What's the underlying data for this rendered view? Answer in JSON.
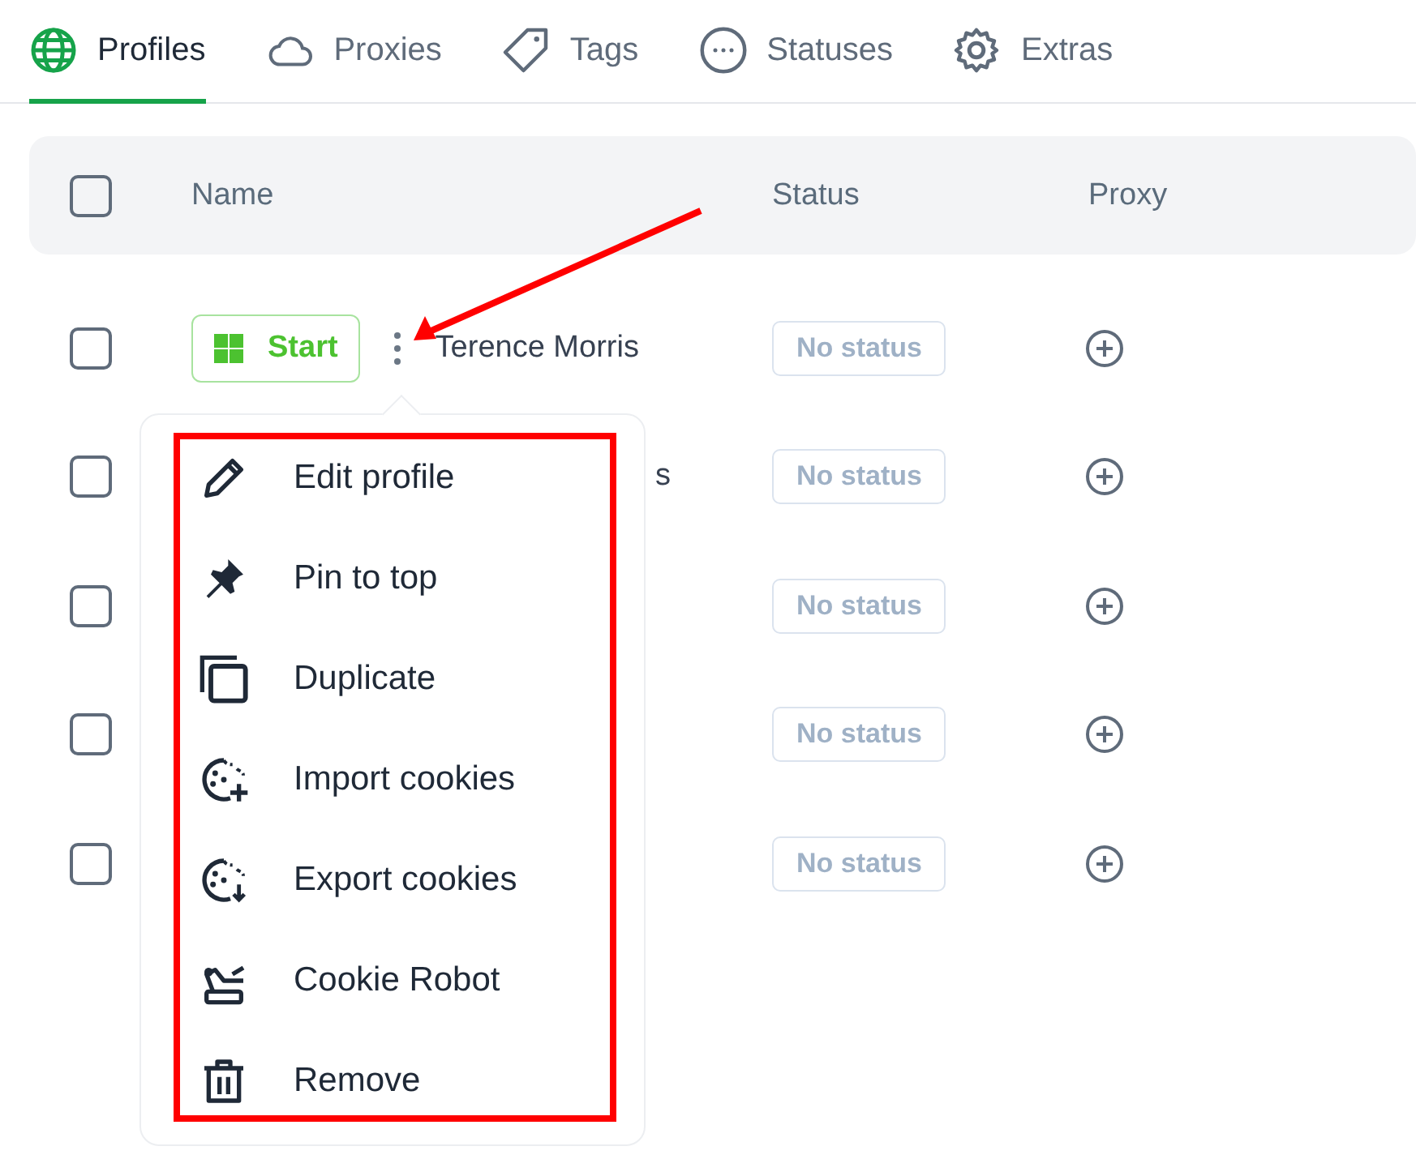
{
  "tabs": [
    {
      "label": "Profiles",
      "selected": true
    },
    {
      "label": "Proxies",
      "selected": false
    },
    {
      "label": "Tags",
      "selected": false
    },
    {
      "label": "Statuses",
      "selected": false
    },
    {
      "label": "Extras",
      "selected": false
    }
  ],
  "table": {
    "header_checked": false,
    "columns": [
      "Name",
      "Status",
      "Proxy"
    ],
    "rows": [
      {
        "checked": false,
        "start_label": "Start",
        "name": "Terence Morris",
        "status": "No status"
      },
      {
        "checked": false,
        "name_fragment": "s",
        "status": "No status"
      },
      {
        "checked": false,
        "status": "No status"
      },
      {
        "checked": false,
        "status": "No status"
      },
      {
        "checked": false,
        "status": "No status"
      }
    ]
  },
  "context_menu": {
    "items": [
      {
        "label": "Edit profile"
      },
      {
        "label": "Pin to top"
      },
      {
        "label": "Duplicate"
      },
      {
        "label": "Import cookies"
      },
      {
        "label": "Export cookies"
      },
      {
        "label": "Cookie Robot"
      },
      {
        "label": "Remove"
      }
    ]
  }
}
